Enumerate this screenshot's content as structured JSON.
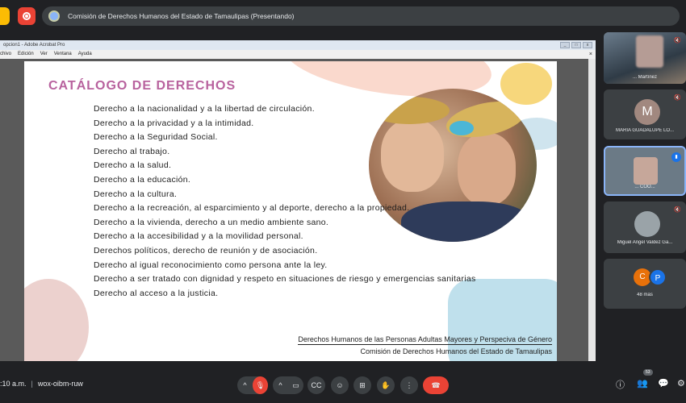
{
  "topbar": {
    "presentation_title": "Comisión de Derechos Humanos del Estado de Tamaulipas (Presentando)"
  },
  "acrobat": {
    "window_title": "opcion1 - Adobe Acrobat Pro",
    "menu": [
      "chivo",
      "Edición",
      "Ver",
      "Ventana",
      "Ayuda"
    ],
    "close_glyph": "×"
  },
  "slide": {
    "title": "CATÁLOGO DE DERECHOS",
    "rights": [
      "Derecho a la nacionalidad y a la libertad de circulación.",
      "Derecho a la privacidad y a la intimidad.",
      "Derecho a la Seguridad Social.",
      "Derecho al trabajo.",
      "Derecho a la salud.",
      "Derecho a la educación.",
      "Derecho a la cultura.",
      "Derecho a la recreación, al esparcimiento y al deporte, derecho a la propiedad.",
      "Derecho a la vivienda, derecho a un medio ambiente sano.",
      "Derecho a la accesibilidad y a la movilidad personal.",
      "Derechos políticos, derecho de reunión y de asociación.",
      "Derecho al igual reconocimiento como persona ante la ley.",
      "Derecho a ser tratado con dignidad y respeto en situaciones de riesgo y emergencias sanitarias",
      "Derecho al acceso a la justicia."
    ],
    "footer_line1": "Derechos Humanos de las Personas Adultas Mayores y Perspeciva de Género",
    "footer_line2": "Comisión de Derechos Humanos del Estado de Tamaulipas"
  },
  "participants": [
    {
      "name": "... Martínez"
    },
    {
      "initial": "M",
      "name": "MARIA GUADALUPE LO..."
    },
    {
      "name": "... COO..."
    },
    {
      "name": "Miguel Angel Valdez Ga..."
    },
    {
      "initials": [
        "C",
        "P"
      ],
      "more": "48 más"
    }
  ],
  "bottombar": {
    "time": ":10 a.m.",
    "meeting_code": "wox-oibm-ruw",
    "people_count": "53"
  },
  "colors": {
    "title_pink": "#b8629e",
    "end_call_red": "#ea4335",
    "background": "#202124"
  },
  "icons": [
    "record-icon",
    "present-icon",
    "mic-off-icon",
    "camera-icon",
    "captions-icon",
    "emoji-icon",
    "present-screen-icon",
    "raise-hand-icon",
    "more-options-icon",
    "end-call-icon",
    "info-icon",
    "people-icon",
    "chat-icon",
    "activities-icon"
  ]
}
